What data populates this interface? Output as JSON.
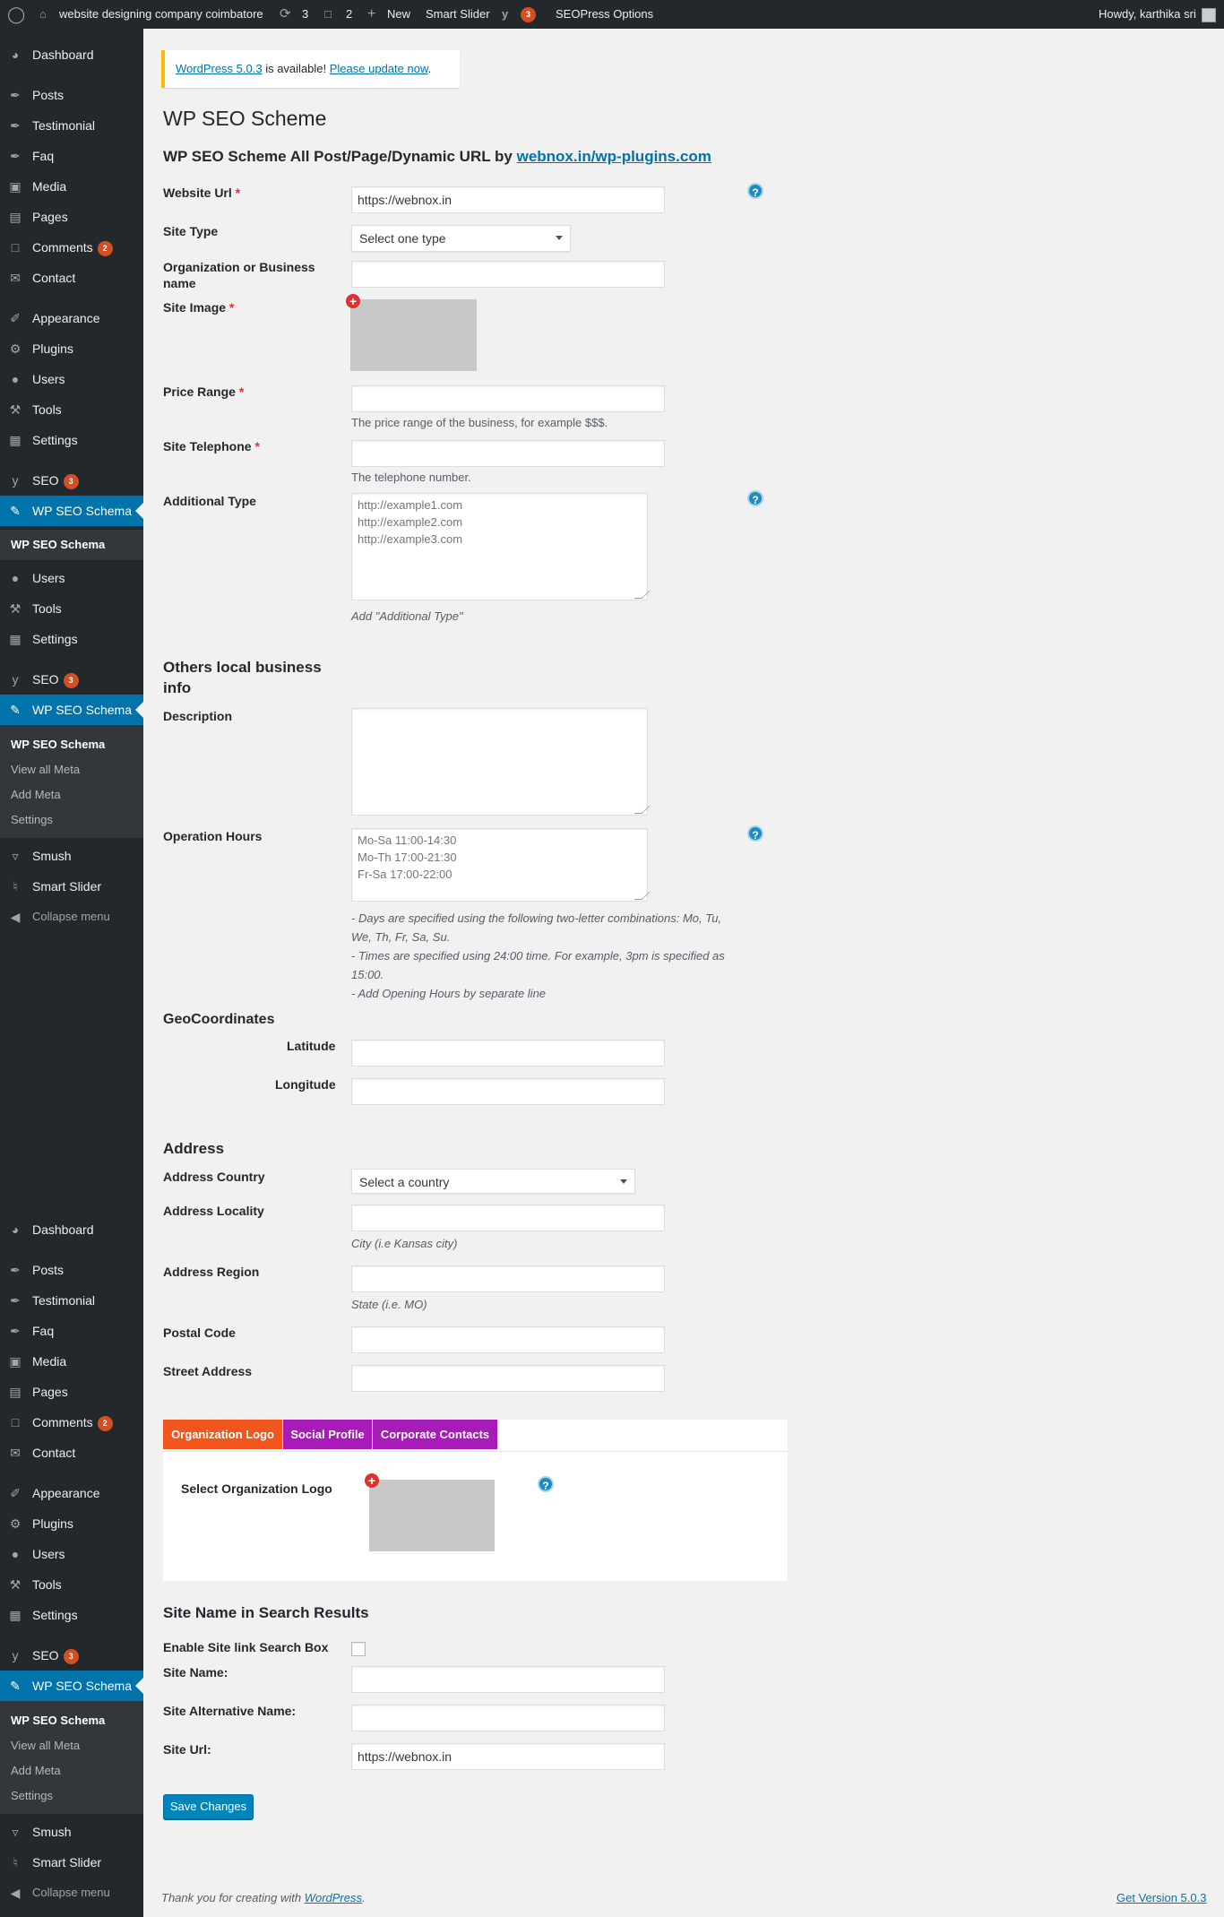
{
  "admin_bar": {
    "site_name": "website designing company coimbatore",
    "updates_count": "3",
    "comments_count": "2",
    "new_label": "New",
    "smart_slider": "Smart Slider",
    "seo_badge": "3",
    "seopress": "SEOPress Options",
    "howdy": "Howdy, karthika sri"
  },
  "sidebar": {
    "dashboard": "Dashboard",
    "posts": "Posts",
    "testimonial": "Testimonial",
    "faq": "Faq",
    "media": "Media",
    "pages": "Pages",
    "comments": "Comments",
    "comments_badge": "2",
    "contact": "Contact",
    "appearance": "Appearance",
    "plugins": "Plugins",
    "users": "Users",
    "tools": "Tools",
    "settings": "Settings",
    "seo": "SEO",
    "seo_badge": "3",
    "wp_seo_schema": "WP SEO Schema",
    "sub_wp_seo_schema": "WP SEO Schema",
    "view_all_meta": "View all Meta",
    "add_meta": "Add Meta",
    "sub_settings": "Settings",
    "smush": "Smush",
    "smart_slider": "Smart Slider",
    "collapse": "Collapse menu"
  },
  "notice": {
    "version_link": "WordPress 5.0.3",
    "text": " is available! ",
    "update_link": "Please update now",
    "end": "."
  },
  "page": {
    "title": "WP SEO Scheme",
    "subtitle": "WP SEO Scheme All Post/Page/Dynamic URL by ",
    "subtitle_link": "webnox.in/wp-plugins.com"
  },
  "form": {
    "website_url_label": "Website Url",
    "website_url_value": "https://webnox.in",
    "site_type_label": "Site Type",
    "site_type_value": "Select one type",
    "org_label": "Organization or Business name",
    "site_image_label": "Site Image",
    "price_range_label": "Price Range",
    "price_range_desc": "The price range of the business, for example $$$.",
    "telephone_label": "Site Telephone",
    "telephone_desc": "The telephone number.",
    "additional_type_label": "Additional Type",
    "additional_type_placeholder": "http://example1.com\nhttp://example2.com\nhttp://example3.com",
    "additional_type_desc": "Add \"Additional Type\"",
    "required_mark": "*"
  },
  "local": {
    "heading": "Others local business info",
    "description_label": "Description",
    "hours_label": "Operation Hours",
    "hours_placeholder": "Mo-Sa 11:00-14:30\nMo-Th 17:00-21:30\nFr-Sa 17:00-22:00",
    "hours_desc_1": "- Days are specified using the following two-letter combinations: Mo, Tu,",
    "hours_desc_2": "We, Th, Fr, Sa, Su.",
    "hours_desc_3": "- Times are specified using 24:00 time. For example, 3pm is specified as",
    "hours_desc_4": "15:00.",
    "hours_desc_5": "- Add Opening Hours by separate line",
    "geo_heading": "GeoCoordinates",
    "latitude": "Latitude",
    "longitude": "Longitude"
  },
  "address": {
    "heading": "Address",
    "country_label": "Address Country",
    "country_value": "Select a country",
    "locality_label": "Address Locality",
    "locality_desc": "City (i.e Kansas city)",
    "region_label": "Address Region",
    "region_desc": "State (i.e. MO)",
    "postal_label": "Postal Code",
    "street_label": "Street Address"
  },
  "tabs": {
    "tab1": "Organization Logo",
    "tab2": "Social Profile",
    "tab3": "Corporate Contacts",
    "select_logo": "Select Organization Logo",
    "colors": {
      "tab1": "#f1561c",
      "tab2": "#a71cb8",
      "tab3": "#a71cb8"
    }
  },
  "site_name": {
    "heading": "Site Name in Search Results",
    "enable_label": "Enable Site link Search Box",
    "name_label": "Site Name:",
    "alt_label": "Site Alternative Name:",
    "url_label": "Site Url:",
    "url_value": "https://webnox.in",
    "save": "Save Changes"
  },
  "footer": {
    "thanks": "Thank you for creating with ",
    "wp_link": "WordPress",
    "end": ".",
    "version": "Get Version 5.0.3"
  },
  "icons": {
    "help": "?",
    "plus": "+"
  }
}
